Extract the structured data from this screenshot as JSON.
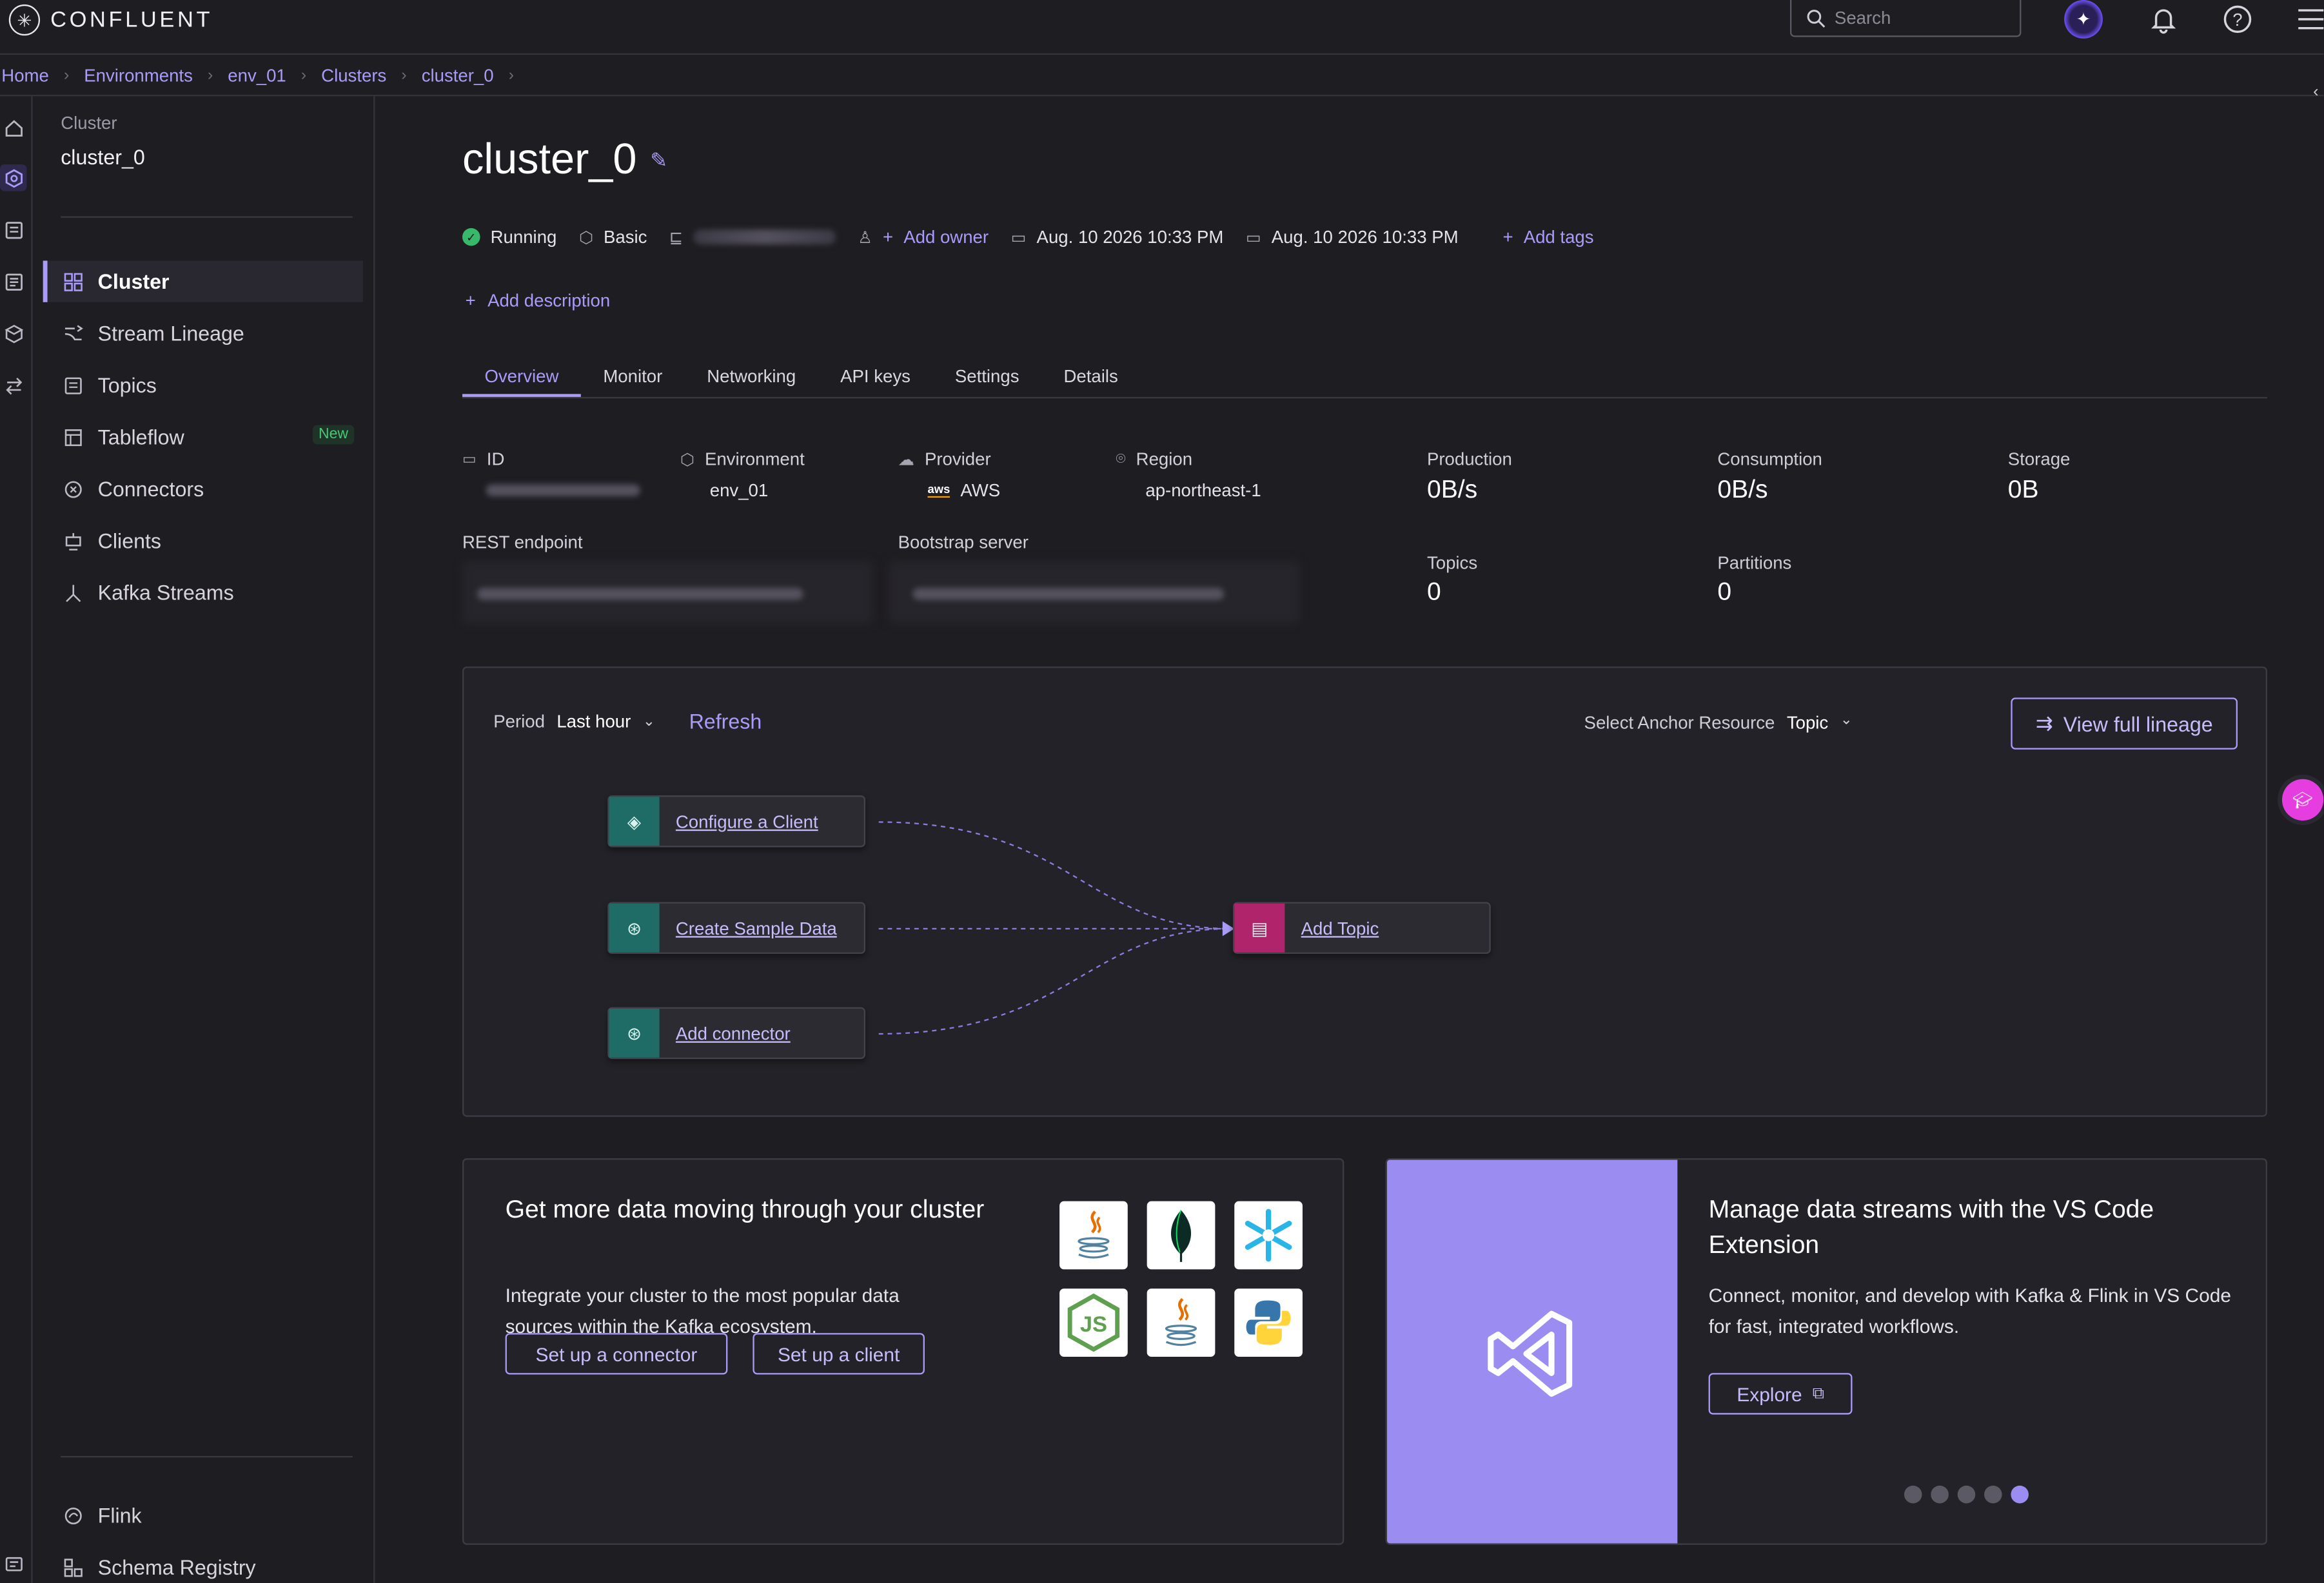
{
  "app": {
    "logo_text": "CONFLUENT"
  },
  "header": {
    "search_placeholder": "Search"
  },
  "breadcrumb": [
    "Home",
    "Environments",
    "env_01",
    "Clusters",
    "cluster_0"
  ],
  "sidebar": {
    "kicker": "Cluster",
    "title": "cluster_0",
    "items": [
      {
        "label": "Cluster",
        "icon": "grid-icon",
        "active": true
      },
      {
        "label": "Stream Lineage",
        "icon": "lineage-icon"
      },
      {
        "label": "Topics",
        "icon": "topics-icon"
      },
      {
        "label": "Tableflow",
        "icon": "tableflow-icon",
        "badge": "New"
      },
      {
        "label": "Connectors",
        "icon": "connector-icon"
      },
      {
        "label": "Clients",
        "icon": "clients-icon"
      },
      {
        "label": "Kafka Streams",
        "icon": "kafka-streams-icon"
      }
    ],
    "bottom_items": [
      {
        "label": "Flink",
        "icon": "flink-icon"
      },
      {
        "label": "Schema Registry",
        "icon": "schema-registry-icon"
      }
    ]
  },
  "page": {
    "title": "cluster_0",
    "status": "Running",
    "type": "Basic",
    "add_owner": "Add owner",
    "created": "Aug. 10 2026 10:33 PM",
    "updated": "Aug. 10 2026 10:33 PM",
    "add_tags": "Add tags",
    "add_description": "Add description"
  },
  "tabs": [
    "Overview",
    "Monitor",
    "Networking",
    "API keys",
    "Settings",
    "Details"
  ],
  "active_tab": "Overview",
  "details": {
    "id_label": "ID",
    "environment_label": "Environment",
    "environment_value": "env_01",
    "provider_label": "Provider",
    "provider_value": "AWS",
    "provider_logo_text": "aws",
    "region_label": "Region",
    "region_value": "ap-northeast-1",
    "rest_label": "REST endpoint",
    "bootstrap_label": "Bootstrap server"
  },
  "metrics": {
    "production_label": "Production",
    "production_value": "0B/s",
    "consumption_label": "Consumption",
    "consumption_value": "0B/s",
    "storage_label": "Storage",
    "storage_value": "0B",
    "topics_label": "Topics",
    "topics_value": "0",
    "partitions_label": "Partitions",
    "partitions_value": "0"
  },
  "lineage": {
    "period_label": "Period",
    "period_value": "Last hour",
    "refresh": "Refresh",
    "anchor_label": "Select Anchor Resource",
    "anchor_value": "Topic",
    "view_full": "View full lineage",
    "nodes": [
      {
        "label": "Configure a Client",
        "color": "#1f6b66"
      },
      {
        "label": "Create Sample Data",
        "color": "#1f6b66"
      },
      {
        "label": "Add connector",
        "color": "#1f6b66"
      },
      {
        "label": "Add Topic",
        "color": "#b0246b"
      }
    ]
  },
  "card_left": {
    "heading": "Get more data moving through your cluster",
    "body": "Integrate your cluster to the most popular data sources within the Kafka ecosystem.",
    "btn_connector": "Set up a connector",
    "btn_client": "Set up a client",
    "logos": [
      "java-logo",
      "mongodb-logo",
      "snowflake-logo",
      "nodejs-logo",
      "java-logo",
      "python-logo"
    ]
  },
  "card_right": {
    "heading": "Manage data streams with the VS Code Extension",
    "body": "Connect, monitor, and develop with Kafka & Flink in VS Code for fast, integrated workflows.",
    "btn_explore": "Explore",
    "carousel_active": 5,
    "carousel_count": 5
  },
  "colors": {
    "accent": "#a99cf8",
    "background": "#1e1d22",
    "success": "#37b86a",
    "vscode_tile": "#9a8cf0"
  }
}
